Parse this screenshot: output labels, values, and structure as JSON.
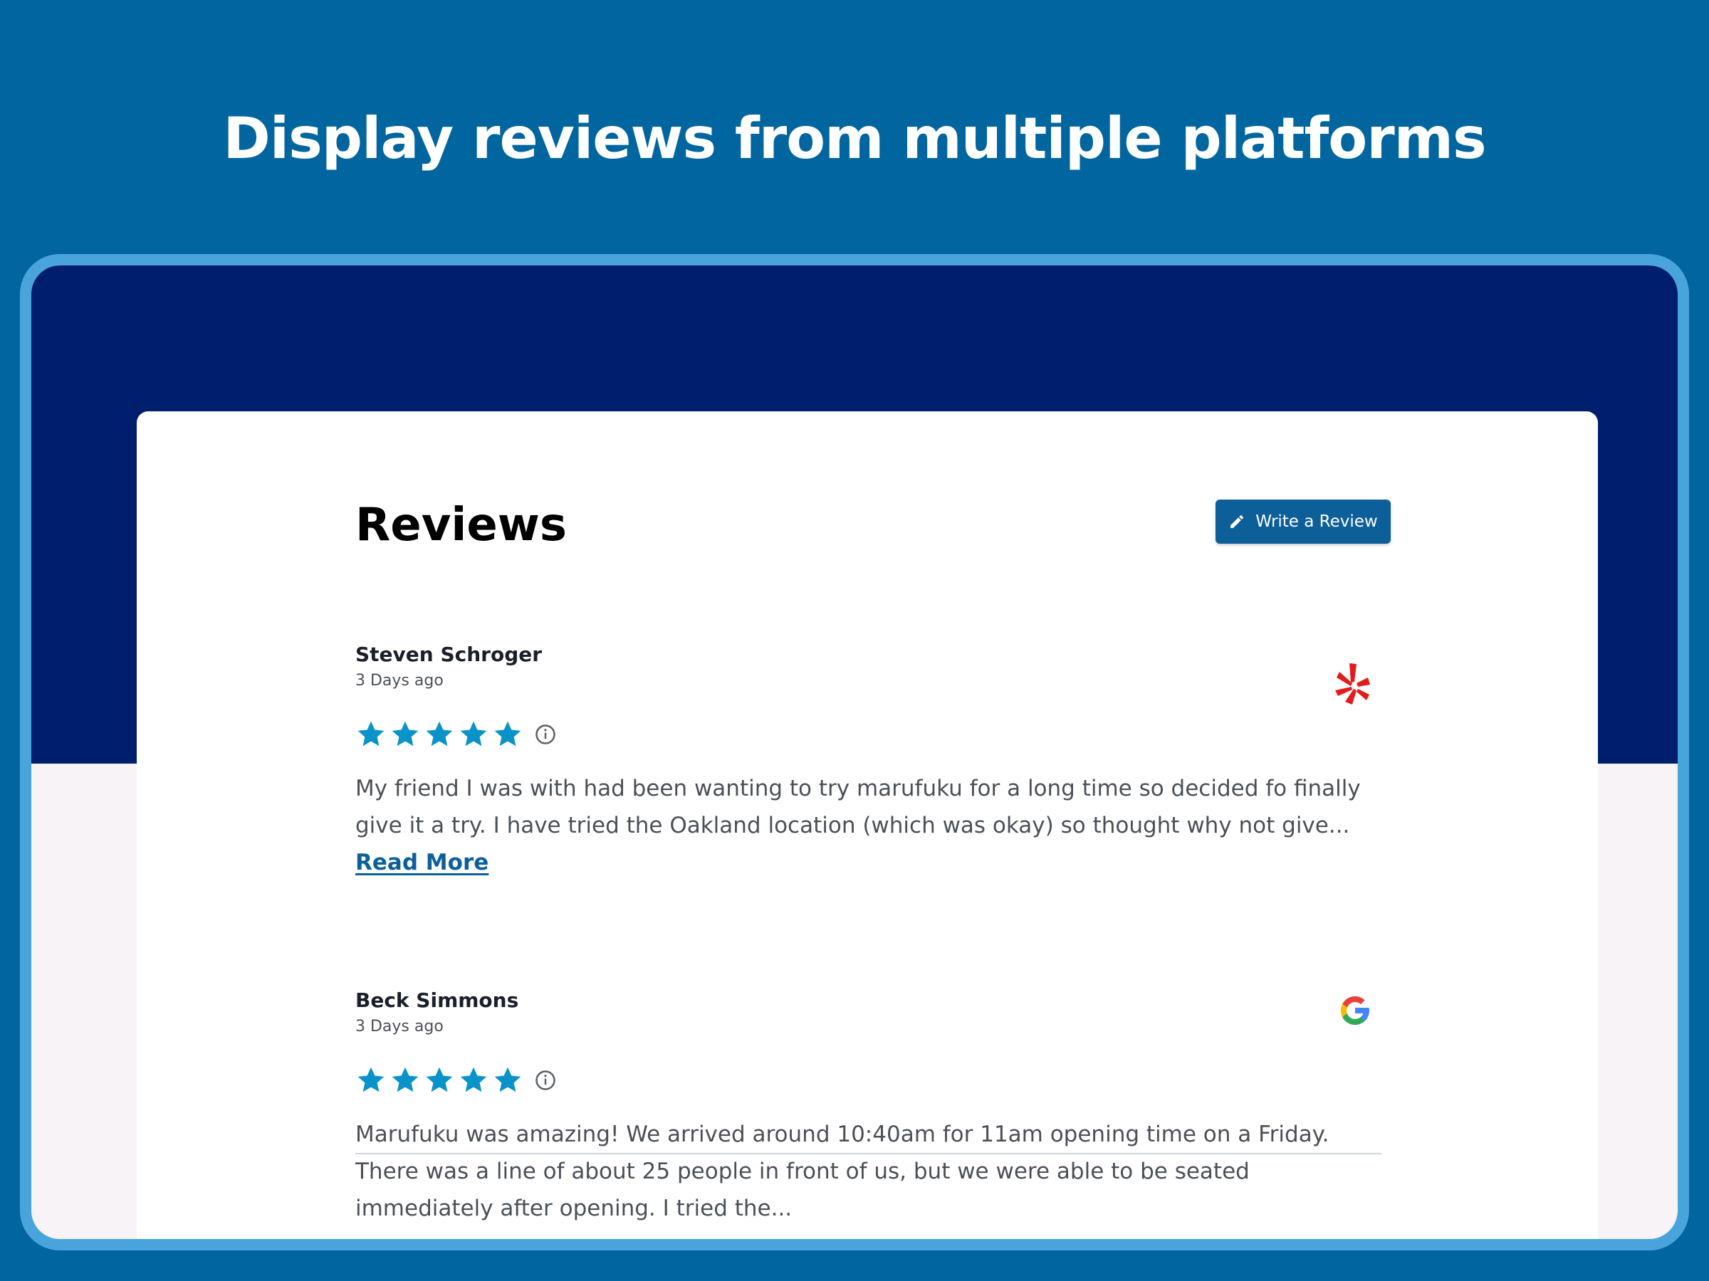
{
  "headline": "Display reviews from multiple platforms",
  "reviews_section": {
    "title": "Reviews",
    "write_button_label": "Write a Review"
  },
  "reviews": [
    {
      "name": "Steven Schroger",
      "date": "3 Days ago",
      "rating": 5,
      "platform": "yelp",
      "platform_icon": "yelp-icon",
      "text": "My friend I was with had been wanting to try marufuku for a long time so decided fo finally give it a try. I have tried the Oakland location (which was okay) so thought why not give...",
      "read_more_label": "Read More"
    },
    {
      "name": "Beck Simmons",
      "date": "3 Days ago",
      "rating": 5,
      "platform": "google",
      "platform_icon": "google-icon",
      "text": "Marufuku was amazing! We arrived around 10:40am for 11am opening time on a Friday. There was a line of about 25 people in front of us, but we were able to be seated immediately after opening. I tried the..."
    }
  ],
  "colors": {
    "background": "#01669f",
    "frame": "#4aa4dc",
    "hero": "#001e6e",
    "button": "#0d5f9a",
    "star": "#0a93c8",
    "yelp": "#e51b1b"
  }
}
